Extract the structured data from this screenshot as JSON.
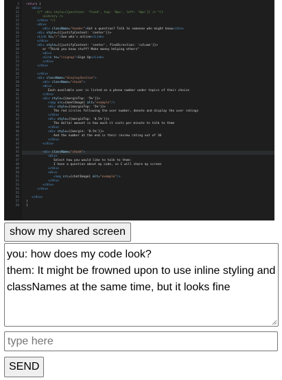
{
  "editor": {
    "lines": [
      {
        "n": "3",
        "i": 0,
        "parts": [
          [
            "kw",
            "return"
          ],
          [
            "txt",
            " ("
          ]
        ]
      },
      {
        "n": "10",
        "i": 1,
        "parts": [
          [
            "tag",
            "<div>"
          ]
        ]
      },
      {
        "n": "11",
        "i": 2,
        "parts": [
          [
            "com",
            "{/* <div style={{position: 'fixed', top: '0px', left: '0px'}} /> */}"
          ]
        ]
      },
      {
        "n": "12",
        "i": 3,
        "parts": [
          [
            "com",
            "<Library />"
          ]
        ]
      },
      {
        "n": "13",
        "i": 2,
        "parts": [
          [
            "tag",
            "</div>"
          ],
          [
            "com",
            " */}"
          ]
        ]
      },
      {
        "n": "14",
        "i": 2,
        "parts": [
          [
            "tag",
            "<div>"
          ]
        ]
      },
      {
        "n": "15",
        "i": 3,
        "parts": [
          [
            "tag",
            "<div "
          ],
          [
            "attr",
            "className"
          ],
          [
            "txt",
            "="
          ],
          [
            "str",
            "\"header\""
          ],
          [
            "tag",
            ">"
          ],
          [
            "txt",
            "Got a question? Talk to someone who might know"
          ],
          [
            "tag",
            "</div>"
          ]
        ]
      },
      {
        "n": "16",
        "i": 2,
        "parts": [
          [
            "tag",
            "<div "
          ],
          [
            "attr",
            "style"
          ],
          [
            "txt",
            "={{justifyContent: 'center'}}>"
          ]
        ]
      },
      {
        "n": "17",
        "i": 2,
        "parts": [
          [
            "tag",
            "<Link "
          ],
          [
            "attr",
            "to"
          ],
          [
            "txt",
            "="
          ],
          [
            "str",
            "\"/\""
          ],
          [
            "tag",
            ">"
          ],
          [
            "txt",
            "See who's online"
          ],
          [
            "tag",
            "</Link>"
          ]
        ]
      },
      {
        "n": "18",
        "i": 2,
        "parts": [
          [
            "tag",
            "</div>"
          ]
        ]
      },
      {
        "n": "19",
        "i": 2,
        "parts": [
          [
            "tag",
            "<div "
          ],
          [
            "attr",
            "style"
          ],
          [
            "txt",
            "={{justifyContent: 'center', flexDirection: 'column'}}>"
          ]
        ]
      },
      {
        "n": "20",
        "i": 3,
        "parts": [
          [
            "txt",
            "or \"Think you know stuff? Make money helping others\""
          ]
        ]
      },
      {
        "n": "21",
        "i": 3,
        "parts": [
          [
            "tag",
            "<div>"
          ]
        ]
      },
      {
        "n": "22",
        "i": 3,
        "parts": [
          [
            "tag",
            "<Link "
          ],
          [
            "attr",
            "to"
          ],
          [
            "txt",
            "="
          ],
          [
            "str",
            "\"/signup\""
          ],
          [
            "tag",
            ">"
          ],
          [
            "txt",
            "Sign Up"
          ],
          [
            "tag",
            "</Link>"
          ]
        ]
      },
      {
        "n": "23",
        "i": 3,
        "parts": [
          [
            "tag",
            "</div>"
          ]
        ]
      },
      {
        "n": "24",
        "i": 2,
        "parts": [
          [
            "tag",
            "</div>"
          ]
        ]
      },
      {
        "n": "25",
        "i": 0,
        "parts": []
      },
      {
        "n": "26",
        "i": 2,
        "parts": [
          [
            "tag",
            "</div>"
          ]
        ]
      },
      {
        "n": "27",
        "i": 2,
        "parts": [
          [
            "tag",
            "<div "
          ],
          [
            "attr",
            "className"
          ],
          [
            "txt",
            "="
          ],
          [
            "str",
            "\"displaySection\""
          ],
          [
            "tag",
            ">"
          ]
        ]
      },
      {
        "n": "28",
        "i": 3,
        "parts": [
          [
            "tag",
            "<div "
          ],
          [
            "attr",
            "className"
          ],
          [
            "txt",
            "="
          ],
          [
            "str",
            "\"chunk\""
          ],
          [
            "tag",
            ">"
          ]
        ]
      },
      {
        "n": "29",
        "i": 3,
        "parts": [
          [
            "tag",
            "<div>"
          ]
        ]
      },
      {
        "n": "30",
        "i": 4,
        "parts": [
          [
            "txt",
            "Each available user is listed as a phone number under topics of their choice"
          ]
        ]
      },
      {
        "n": "31",
        "i": 3,
        "parts": [
          [
            "tag",
            "</div>"
          ]
        ]
      },
      {
        "n": "32",
        "i": 3,
        "parts": [
          [
            "tag",
            "<div "
          ],
          [
            "attr",
            "style"
          ],
          [
            "txt",
            "={{marginTop: '5%'}}>"
          ]
        ]
      },
      {
        "n": "33",
        "i": 4,
        "parts": [
          [
            "tag",
            "<img "
          ],
          [
            "attr",
            "src"
          ],
          [
            "txt",
            "={meetImage} "
          ],
          [
            "attr",
            "alt"
          ],
          [
            "txt",
            "="
          ],
          [
            "str",
            "\"example\""
          ],
          [
            "tag",
            "/>"
          ]
        ]
      },
      {
        "n": "34",
        "i": 4,
        "parts": [
          [
            "tag",
            "<div "
          ],
          [
            "attr",
            "style"
          ],
          [
            "txt",
            "={{marginTop: '5%'}}>"
          ]
        ]
      },
      {
        "n": "35",
        "i": 5,
        "parts": [
          [
            "txt",
            "The red circles following the user number, denote and display the user ratings"
          ]
        ]
      },
      {
        "n": "36",
        "i": 4,
        "parts": [
          [
            "tag",
            "</div>"
          ]
        ]
      },
      {
        "n": "37",
        "i": 4,
        "parts": [
          [
            "tag",
            "<div "
          ],
          [
            "attr",
            "style"
          ],
          [
            "txt",
            "={{marginTop: '0.5%'}}>"
          ]
        ]
      },
      {
        "n": "38",
        "i": 5,
        "parts": [
          [
            "txt",
            "The dollar amount is how much it costs per minute to talk to them"
          ]
        ]
      },
      {
        "n": "39",
        "i": 4,
        "parts": [
          [
            "tag",
            "</div>"
          ]
        ]
      },
      {
        "n": "40",
        "i": 4,
        "parts": [
          [
            "tag",
            "<div "
          ],
          [
            "attr",
            "style"
          ],
          [
            "txt",
            "={{margin: '0.5%'}}>"
          ]
        ]
      },
      {
        "n": "41",
        "i": 5,
        "parts": [
          [
            "txt",
            "And the number at the end is their review rating out of 10"
          ]
        ]
      },
      {
        "n": "42",
        "i": 4,
        "parts": [
          [
            "tag",
            "</div>"
          ]
        ]
      },
      {
        "n": "43",
        "i": 3,
        "parts": [
          [
            "tag",
            "</div>"
          ]
        ]
      },
      {
        "n": "44",
        "i": 0,
        "parts": []
      },
      {
        "n": "45",
        "i": 3,
        "parts": [
          [
            "tag",
            "<div "
          ],
          [
            "attr",
            "className"
          ],
          [
            "txt",
            "="
          ],
          [
            "str",
            "\"chunk\""
          ],
          [
            "tag",
            ">"
          ]
        ]
      },
      {
        "n": "46",
        "i": 4,
        "parts": [
          [
            "tag",
            "<div>"
          ]
        ]
      },
      {
        "n": "47",
        "i": 5,
        "parts": [
          [
            "txt",
            "Select how you would like to talk to them:"
          ]
        ]
      },
      {
        "n": "48",
        "i": 5,
        "parts": [
          [
            "txt",
            "I have a question about my code, so I will share my screen"
          ]
        ]
      },
      {
        "n": "49",
        "i": 4,
        "parts": [
          [
            "tag",
            "</div>"
          ]
        ]
      },
      {
        "n": "50",
        "i": 4,
        "parts": [
          [
            "tag",
            "<div>"
          ]
        ]
      },
      {
        "n": "51",
        "i": 5,
        "parts": [
          [
            "tag",
            "<img "
          ],
          [
            "attr",
            "src"
          ],
          [
            "txt",
            "={chatImage} "
          ],
          [
            "attr",
            "alt"
          ],
          [
            "txt",
            "="
          ],
          [
            "str",
            "\"example\""
          ],
          [
            "tag",
            "/>"
          ]
        ]
      },
      {
        "n": "52",
        "i": 4,
        "parts": [
          [
            "tag",
            "</div>"
          ]
        ]
      },
      {
        "n": "53",
        "i": 3,
        "parts": [
          [
            "tag",
            "</div>"
          ]
        ]
      },
      {
        "n": "54",
        "i": 2,
        "parts": [
          [
            "tag",
            "</div>"
          ]
        ]
      },
      {
        "n": "55",
        "i": 0,
        "parts": []
      },
      {
        "n": "56",
        "i": 1,
        "parts": [
          [
            "tag",
            "</div>"
          ]
        ]
      },
      {
        "n": "57",
        "i": 0,
        "parts": [
          [
            "txt",
            ")"
          ]
        ]
      },
      {
        "n": "58",
        "i": 0,
        "parts": [
          [
            "txt",
            "}"
          ]
        ]
      }
    ],
    "active_line": "45"
  },
  "share_button": {
    "label": "show my shared screen"
  },
  "chat": {
    "lines": [
      "you: how does my code look?",
      "them: It might be frowned upon to use inline styling and",
      "classNames at the same time, but it looks fine"
    ]
  },
  "message_input": {
    "value": "",
    "placeholder": "type here"
  },
  "send_button": {
    "label": "SEND"
  },
  "colors": {
    "editor_bg": "#1e1e1e",
    "tag": "#569cd6",
    "attr": "#9cdcfe",
    "string": "#ce9178",
    "keyword": "#c586c0",
    "comment": "#6a9955"
  }
}
